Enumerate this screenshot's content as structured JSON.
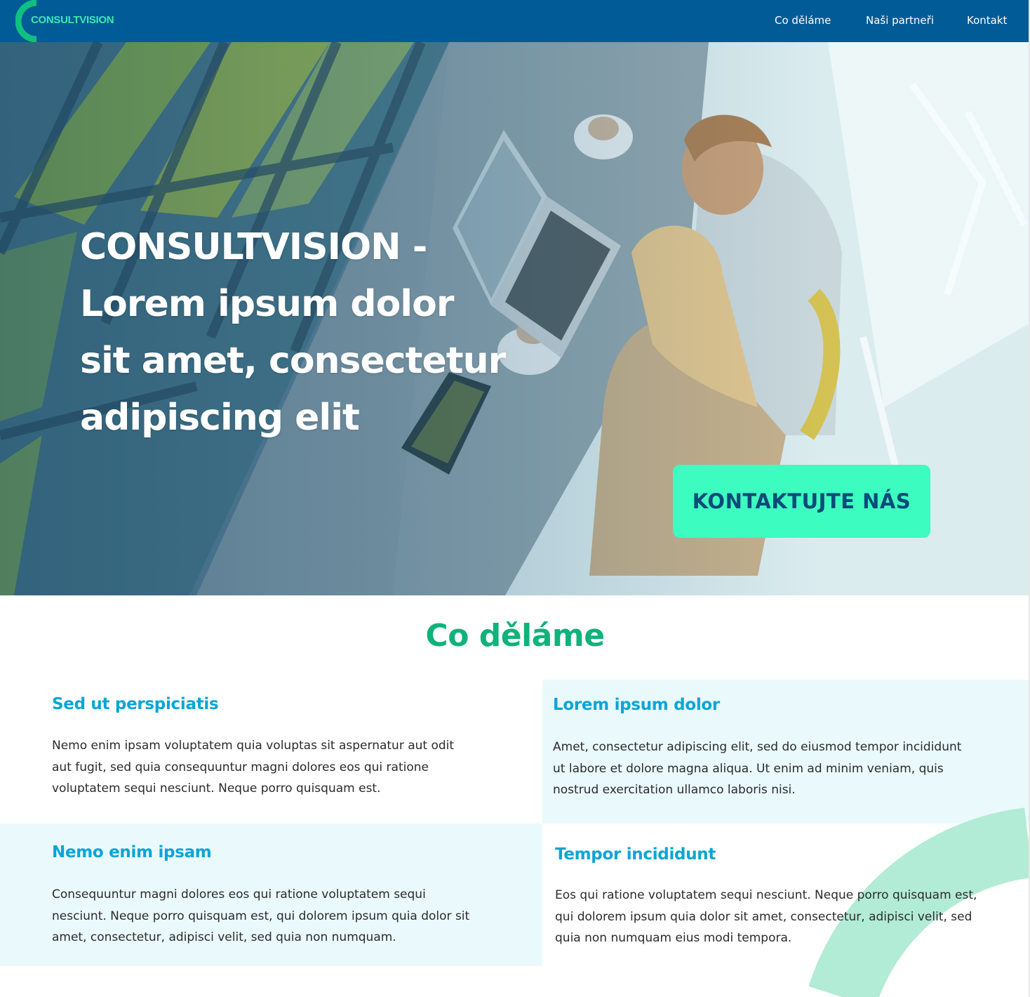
{
  "nav": {
    "logo_text": "CONSULTVISION",
    "links": [
      "Co děláme",
      "Naši partneři",
      "Kontakt"
    ]
  },
  "hero": {
    "title": "CONSULTVISION - Lorem ipsum dolor sit amet, consectetur adipiscing elit",
    "cta_label": "KONTAKTUJTE NÁS"
  },
  "section": {
    "title": "Co děláme",
    "items": [
      {
        "heading": "Sed ut perspiciatis",
        "text": "Nemo enim ipsam voluptatem quia voluptas sit aspernatur aut odit aut fugit, sed quia consequuntur magni dolores eos qui ratione voluptatem sequi nesciunt. Neque porro quisquam est."
      },
      {
        "heading": "Lorem ipsum dolor",
        "text": "Amet, consectetur adipiscing elit, sed do eiusmod tempor incididunt ut labore et dolore magna aliqua. Ut enim ad minim veniam, quis nostrud exercitation ullamco laboris nisi."
      },
      {
        "heading": "Nemo enim ipsam",
        "text": "Consequuntur magni dolores eos qui ratione voluptatem sequi nesciunt. Neque porro quisquam est, qui dolorem ipsum quia dolor sit amet, consectetur, adipisci velit, sed quia non numquam."
      },
      {
        "heading": "Tempor incididunt",
        "text": "Eos qui ratione voluptatem sequi nesciunt. Neque porro quisquam est, qui dolorem ipsum quia dolor sit amet, consectetur, adipisci velit, sed quia non numquam eius modi tempora."
      }
    ]
  },
  "colors": {
    "nav_bg": "#005b97",
    "accent_green": "#10b27a",
    "cta_bg": "#3cfcc0",
    "heading_blue": "#0aa5d6",
    "panel_tint": "#eaf9fc"
  },
  "icons": [
    "logo-arc-icon",
    "decorative-arc"
  ]
}
